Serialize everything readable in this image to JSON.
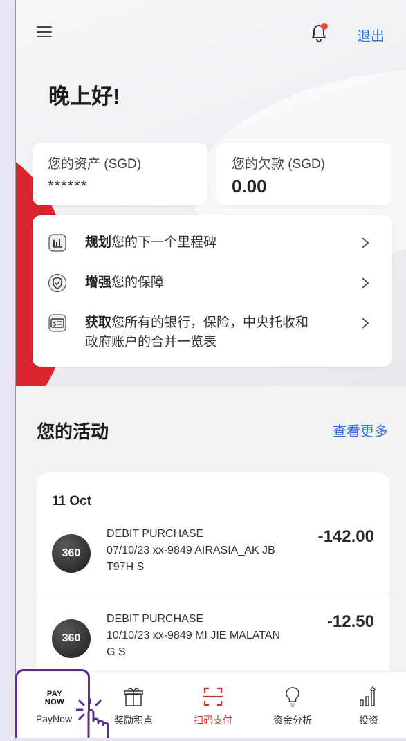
{
  "header": {
    "menu_icon": "hamburger-icon",
    "notification_icon": "bell-icon",
    "notification_dot_color": "#e24a3b",
    "logout_label": "退出"
  },
  "greeting": "晚上好!",
  "summary": {
    "assets": {
      "label": "您的资产 (SGD)",
      "value": "******"
    },
    "debt": {
      "label": "您的欠款 (SGD)",
      "value": "0.00"
    }
  },
  "actions": [
    {
      "icon": "bar-chart-icon",
      "bold": "规划",
      "text": "您的下一个里程碑"
    },
    {
      "icon": "shield-check-icon",
      "bold": "增强",
      "text": "您的保障"
    },
    {
      "icon": "dollar-bill-icon",
      "bold": "获取",
      "text": "您所有的银行，保险，中央托收和",
      "text2": "政府账户的合并一览表"
    }
  ],
  "activity": {
    "title": "您的活动",
    "see_more": "查看更多",
    "date": "11 Oct",
    "transactions": [
      {
        "badge": "360",
        "line1": "DEBIT PURCHASE",
        "line2": "07/10/23 xx-9849 AIRASIA_AK JB",
        "line3": "T97H S",
        "amount": "-142.00"
      },
      {
        "badge": "360",
        "line1": "DEBIT PURCHASE",
        "line2": "10/10/23 xx-9849 MI JIE MALATAN",
        "line3": "G S",
        "amount": "-12.50"
      }
    ]
  },
  "tabbar": {
    "tabs": [
      {
        "label": "PayNow",
        "icon": "paynow-logo",
        "logo_line1": "PAY",
        "logo_line2": "NOW"
      },
      {
        "label": "奖励积点",
        "icon": "gift-icon"
      },
      {
        "label": "扫码支付",
        "icon": "scan-qr-icon",
        "active": true
      },
      {
        "label": "资金分析",
        "icon": "lightbulb-icon"
      },
      {
        "label": "投资",
        "icon": "growth-chart-icon"
      }
    ]
  },
  "colors": {
    "accent_blue": "#2f6fd6",
    "brand_red": "#d9262c",
    "highlight_purple": "#5b2d8e"
  }
}
